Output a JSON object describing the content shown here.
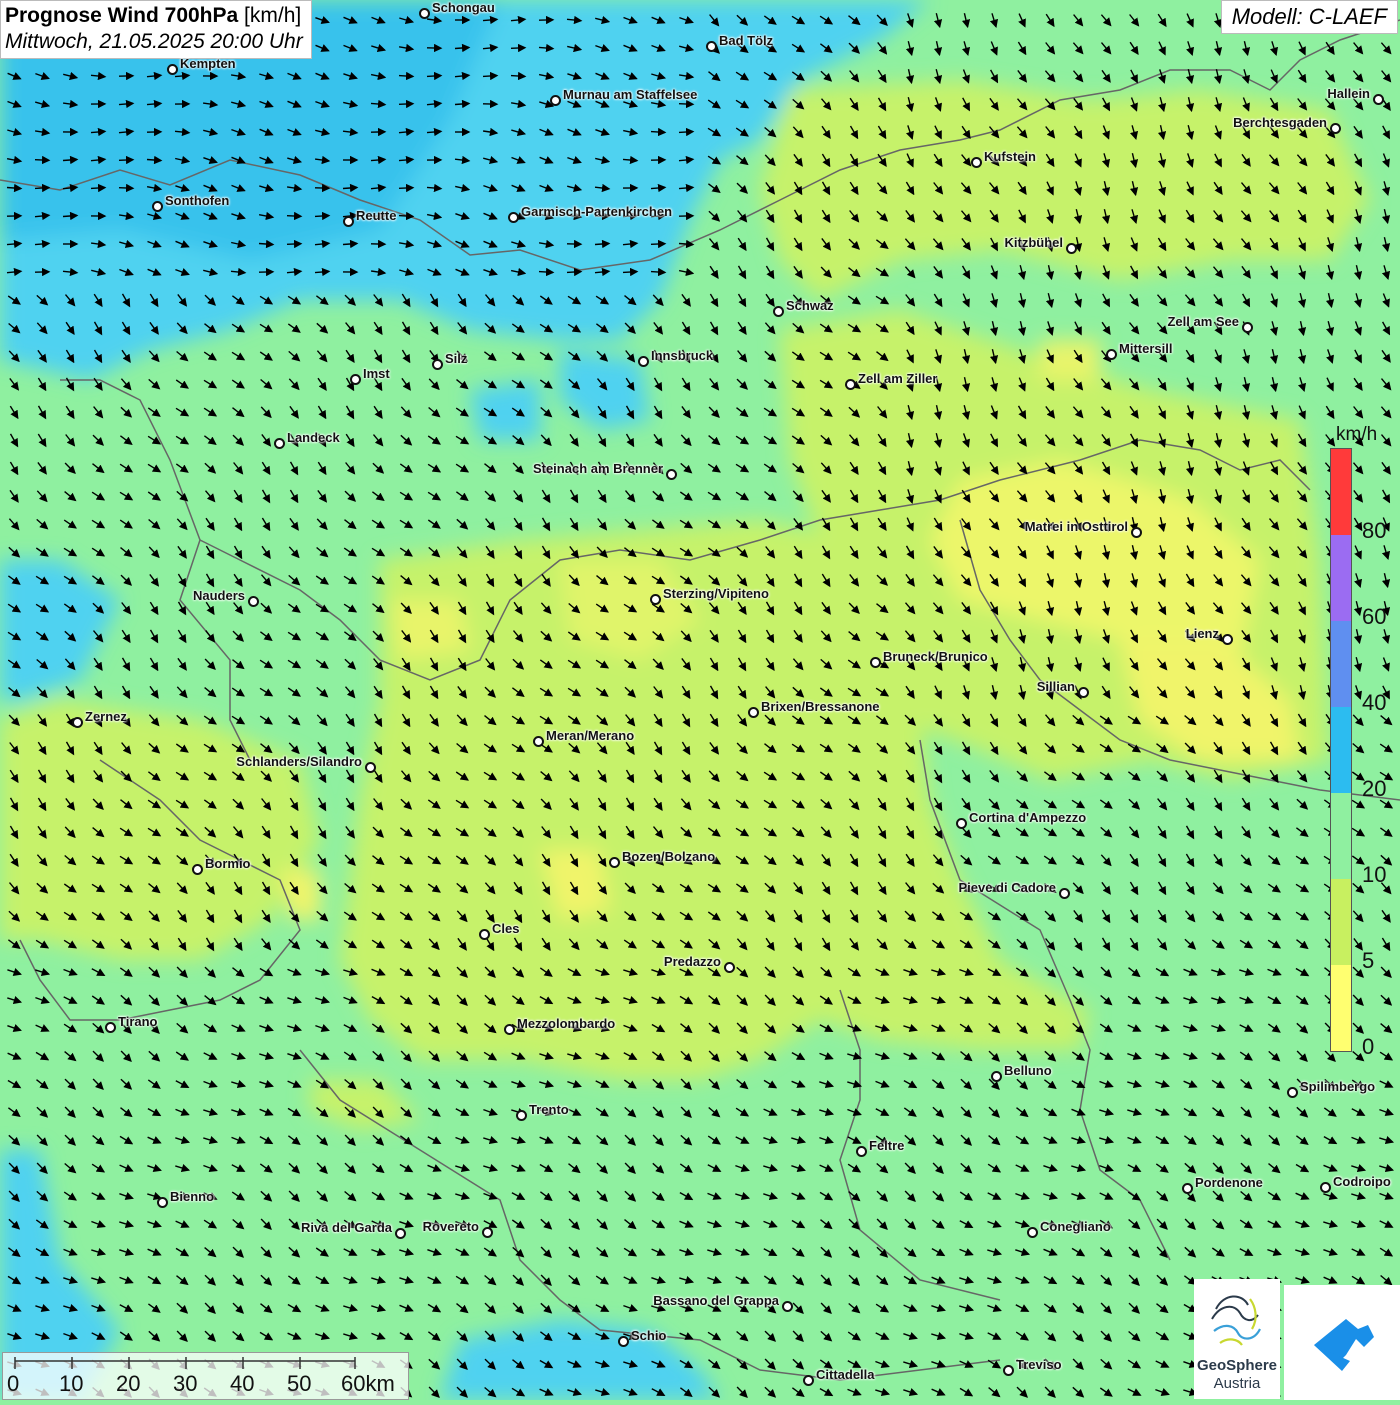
{
  "header": {
    "title_bold": "Prognose Wind 700hPa",
    "title_unit": " [km/h]",
    "datetime": "Mittwoch, 21.05.2025 20:00 Uhr",
    "model": "Modell: C-LAEF"
  },
  "legend": {
    "unit": "km/h",
    "ticks": [
      "80",
      "60",
      "40",
      "20",
      "10",
      "5",
      "0"
    ],
    "colors": [
      "#ff3a3a",
      "#9b6cf2",
      "#5f8ff0",
      "#2cbcf0",
      "#8ff0a0",
      "#c8f060",
      "#ffff70"
    ]
  },
  "scale": {
    "labels": [
      "0",
      "10",
      "20",
      "30",
      "40",
      "50",
      "60km"
    ]
  },
  "logo": {
    "name1": "GeoSphere",
    "name2": "Austria"
  },
  "cities": [
    {
      "name": "Schongau"
    },
    {
      "name": "Bad Tölz"
    },
    {
      "name": "Kempten"
    },
    {
      "name": "Murnau am Staffelsee"
    },
    {
      "name": "Hallein"
    },
    {
      "name": "Berchtesgaden"
    },
    {
      "name": "Kufstein"
    },
    {
      "name": "Sonthofen"
    },
    {
      "name": "Reutte"
    },
    {
      "name": "Garmisch-Partenkirchen"
    },
    {
      "name": "Kitzbühel"
    },
    {
      "name": "Schwaz"
    },
    {
      "name": "Zell am See"
    },
    {
      "name": "Mittersill"
    },
    {
      "name": "Innsbruck"
    },
    {
      "name": "Silz"
    },
    {
      "name": "Imst"
    },
    {
      "name": "Zell am Ziller"
    },
    {
      "name": "Landeck"
    },
    {
      "name": "Steinach am Brenner"
    },
    {
      "name": "Matrei in Osttirol"
    },
    {
      "name": "Nauders"
    },
    {
      "name": "Sterzing/Vipiteno"
    },
    {
      "name": "Lienz"
    },
    {
      "name": "Bruneck/Brunico"
    },
    {
      "name": "Sillian"
    },
    {
      "name": "Brixen/Bressanone"
    },
    {
      "name": "Zernez"
    },
    {
      "name": "Meran/Merano"
    },
    {
      "name": "Schlanders/Silandro"
    },
    {
      "name": "Cortina d'Ampezzo"
    },
    {
      "name": "Bozen/Bolzano"
    },
    {
      "name": "Bormio"
    },
    {
      "name": "Pieve di Cadore"
    },
    {
      "name": "Cles"
    },
    {
      "name": "Predazzo"
    },
    {
      "name": "Tirano"
    },
    {
      "name": "Mezzolombardo"
    },
    {
      "name": "Belluno"
    },
    {
      "name": "Spilimbergo"
    },
    {
      "name": "Trento"
    },
    {
      "name": "Feltre"
    },
    {
      "name": "Pordenone"
    },
    {
      "name": "Codroipo"
    },
    {
      "name": "Bienno"
    },
    {
      "name": "Riva del Garda"
    },
    {
      "name": "Rovereto"
    },
    {
      "name": "Conegliano"
    },
    {
      "name": "Bassano del Grappa"
    },
    {
      "name": "Schio"
    },
    {
      "name": "Treviso"
    },
    {
      "name": "Cittadella"
    }
  ]
}
